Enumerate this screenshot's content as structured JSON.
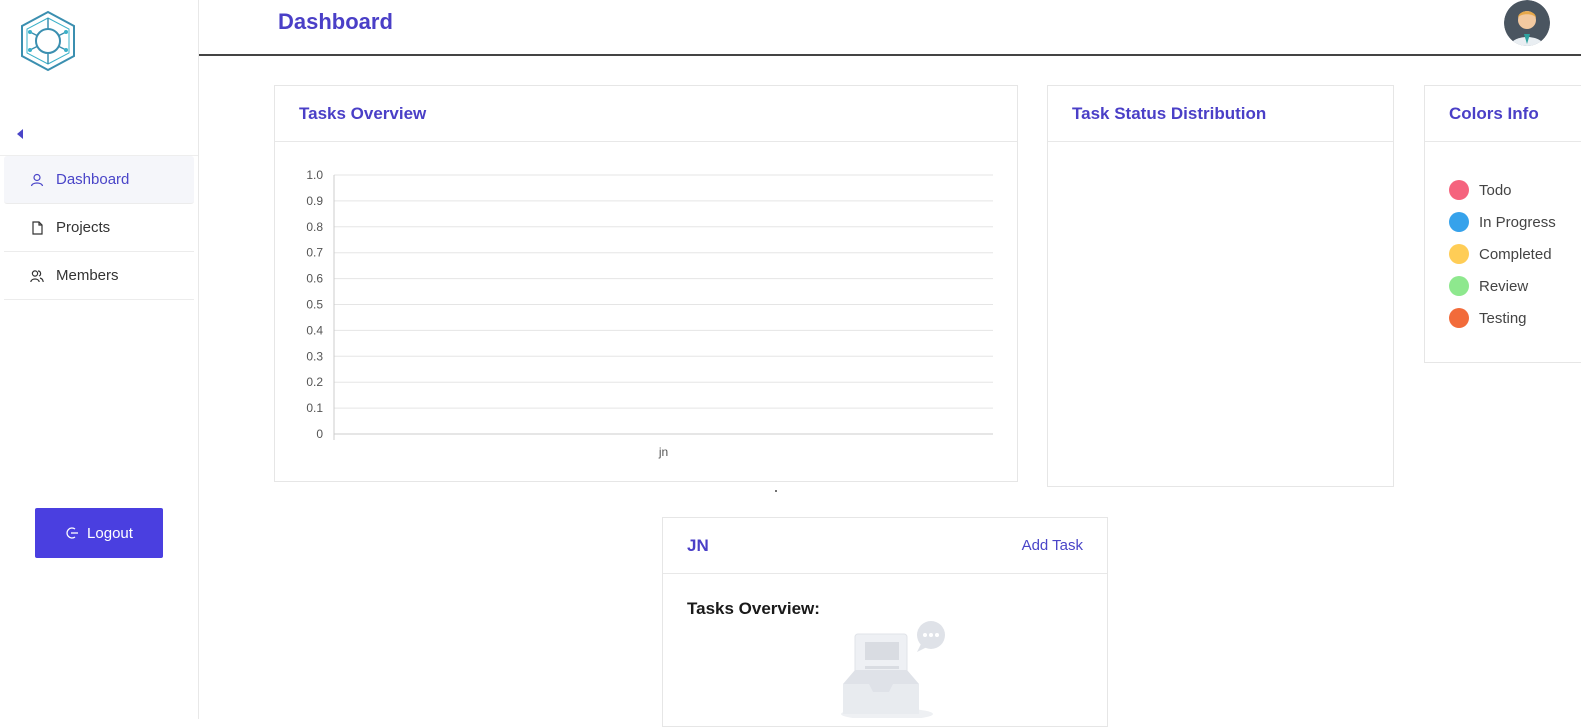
{
  "header": {
    "title": "Dashboard"
  },
  "sidebar": {
    "items": [
      {
        "label": "Dashboard",
        "icon": "user-icon",
        "active": true
      },
      {
        "label": "Projects",
        "icon": "file-icon",
        "active": false
      },
      {
        "label": "Members",
        "icon": "users-icon",
        "active": false
      }
    ],
    "logout_label": "Logout"
  },
  "tasks_overview": {
    "title": "Tasks Overview"
  },
  "chart_data": {
    "type": "bar",
    "categories": [
      "jn"
    ],
    "series": [],
    "title": "",
    "xlabel": "",
    "ylabel": "",
    "ylim": [
      0,
      1.0
    ],
    "y_ticks": [
      "0",
      "0.1",
      "0.2",
      "0.3",
      "0.4",
      "0.5",
      "0.6",
      "0.7",
      "0.8",
      "0.9",
      "1.0"
    ],
    "grid": true
  },
  "status_distribution": {
    "title": "Task Status Distribution"
  },
  "colors_info": {
    "title": "Colors Info",
    "items": [
      {
        "label": "Todo",
        "color": "#f5637e"
      },
      {
        "label": "In Progress",
        "color": "#36a2eb"
      },
      {
        "label": "Completed",
        "color": "#ffcd56"
      },
      {
        "label": "Review",
        "color": "#8ee88e"
      },
      {
        "label": "Testing",
        "color": "#f26b3a"
      }
    ]
  },
  "project": {
    "name": "JN",
    "add_task_label": "Add Task",
    "overview_label": "Tasks Overview:"
  }
}
